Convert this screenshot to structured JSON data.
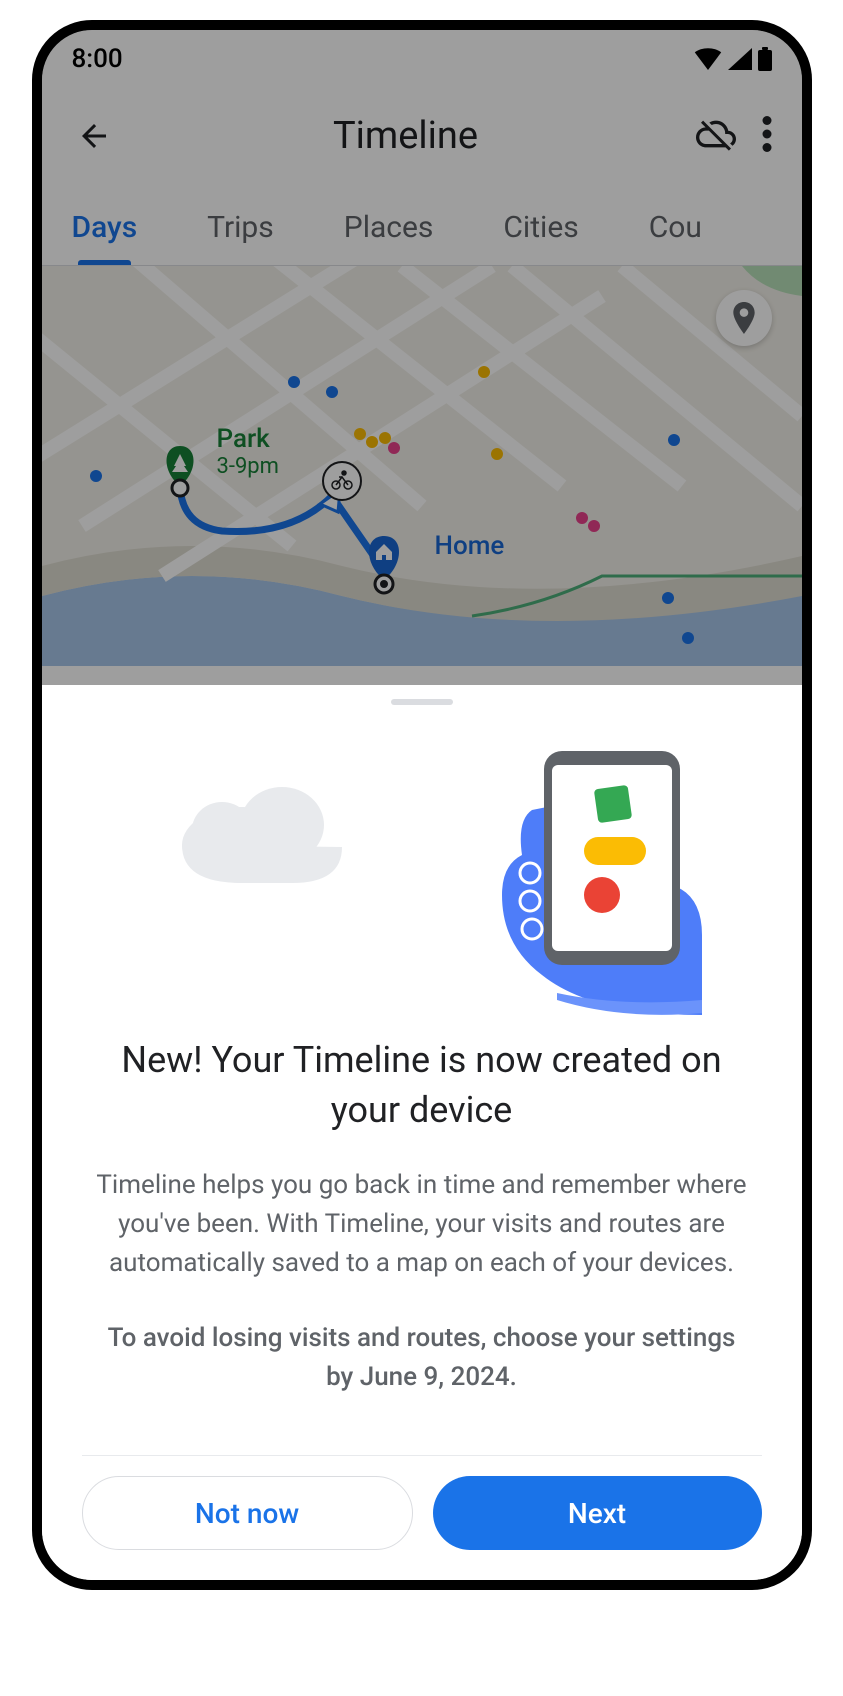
{
  "status_bar": {
    "time": "8:00"
  },
  "header": {
    "title": "Timeline"
  },
  "tabs": {
    "items": [
      {
        "label": "Days",
        "active": true
      },
      {
        "label": "Trips",
        "active": false
      },
      {
        "label": "Places",
        "active": false
      },
      {
        "label": "Cities",
        "active": false
      },
      {
        "label": "Cou",
        "active": false
      }
    ]
  },
  "map": {
    "park": {
      "label": "Park",
      "time": "3-9pm"
    },
    "home": {
      "label": "Home"
    }
  },
  "sheet": {
    "title": "New! Your Timeline is now created on your device",
    "body": "Timeline helps you go back in time and remember where you've been.  With Timeline, your visits and routes are automatically saved to a map on each of your devices.",
    "warning": "To avoid losing visits and routes, choose your settings by June 9, 2024.",
    "secondary_btn": "Not now",
    "primary_btn": "Next"
  }
}
